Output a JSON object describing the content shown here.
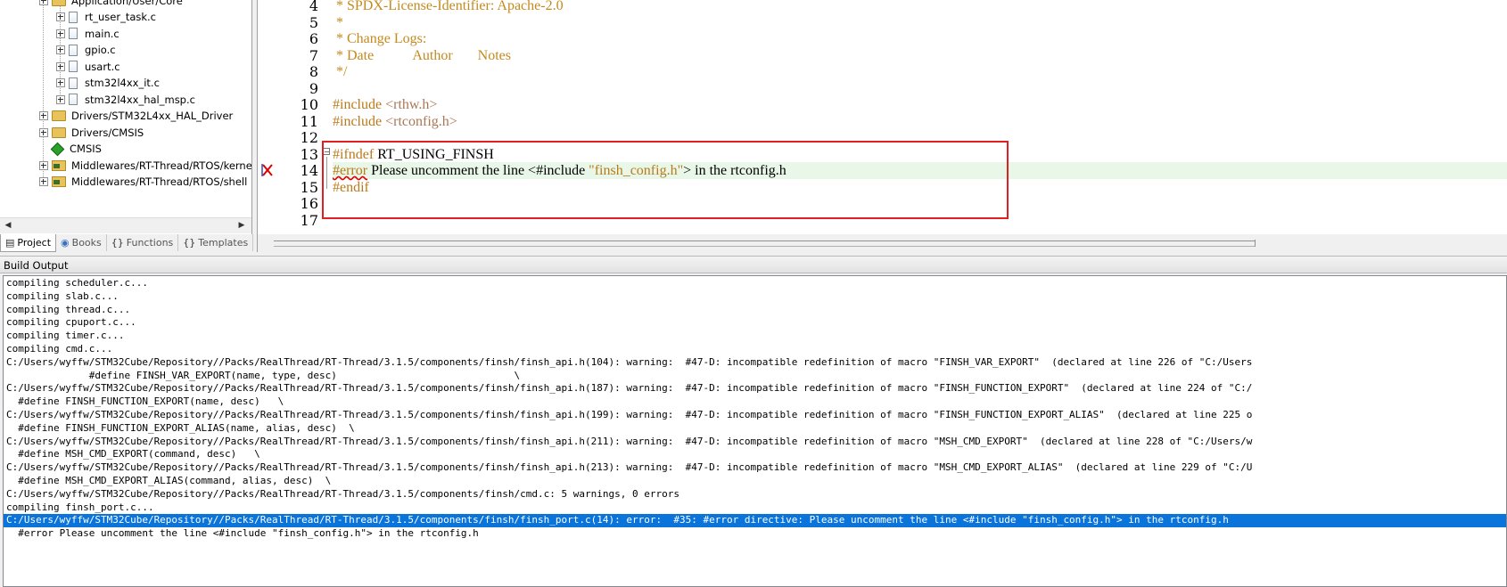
{
  "tree": {
    "top_group_label": "Application/User/Core",
    "files": [
      "rt_user_task.c",
      "main.c",
      "gpio.c",
      "usart.c",
      "stm32l4xx_it.c",
      "stm32l4xx_hal_msp.c"
    ],
    "groups": [
      {
        "label": "Drivers/STM32L4xx_HAL_Driver",
        "icon": "folder-icon"
      },
      {
        "label": "Drivers/CMSIS",
        "icon": "folder-icon"
      },
      {
        "label": "CMSIS",
        "icon": "cmsis-diamond-icon"
      },
      {
        "label": "Middlewares/RT-Thread/RTOS/kernel",
        "icon": "component-folder-icon"
      },
      {
        "label": "Middlewares/RT-Thread/RTOS/shell",
        "icon": "component-folder-icon"
      }
    ]
  },
  "tree_tabs": [
    {
      "label": "Project",
      "icon": "project-icon",
      "active": true
    },
    {
      "label": "Books",
      "icon": "books-icon",
      "active": false
    },
    {
      "label": "Functions",
      "icon": "{}",
      "active": false
    },
    {
      "label": "Templates",
      "icon": "{}",
      "active": false
    }
  ],
  "editor": {
    "line_numbers": [
      "4",
      "5",
      "6",
      "7",
      "8",
      "9",
      "10",
      "11",
      "12",
      "13",
      "14",
      "15",
      "16",
      "17"
    ],
    "lines": {
      "l4": " * SPDX-License-Identifier: Apache-2.0",
      "l5": " *",
      "l6": " * Change Logs:",
      "l7": " * Date           Author       Notes",
      "l8": " */",
      "l10_kw": "#include ",
      "l10_hdr": "<rthw.h>",
      "l11_kw": "#include ",
      "l11_hdr": "<rtconfig.h>",
      "l13_kw": "#ifndef",
      "l13_rest": " RT_USING_FINSH",
      "l14_kw": "#error",
      "l14_a": " Please uncomment the line <#include ",
      "l14_str": "\"finsh_config.h\"",
      "l14_b": "> in the rtconfig.h",
      "l15_kw": "#endif"
    },
    "highlight_color": "#e8f7e8",
    "annotation_color": "#e02020"
  },
  "build": {
    "title": "Build Output",
    "lines": [
      "compiling scheduler.c...",
      "compiling slab.c...",
      "compiling thread.c...",
      "compiling cpuport.c...",
      "compiling timer.c...",
      "compiling cmd.c...",
      "C:/Users/wyffw/STM32Cube/Repository//Packs/RealThread/RT-Thread/3.1.5/components/finsh/finsh_api.h(104): warning:  #47-D: incompatible redefinition of macro \"FINSH_VAR_EXPORT\"  (declared at line 226 of \"C:/Users",
      "              #define FINSH_VAR_EXPORT(name, type, desc)                              \\",
      "C:/Users/wyffw/STM32Cube/Repository//Packs/RealThread/RT-Thread/3.1.5/components/finsh/finsh_api.h(187): warning:  #47-D: incompatible redefinition of macro \"FINSH_FUNCTION_EXPORT\"  (declared at line 224 of \"C:/",
      "  #define FINSH_FUNCTION_EXPORT(name, desc)   \\",
      "C:/Users/wyffw/STM32Cube/Repository//Packs/RealThread/RT-Thread/3.1.5/components/finsh/finsh_api.h(199): warning:  #47-D: incompatible redefinition of macro \"FINSH_FUNCTION_EXPORT_ALIAS\"  (declared at line 225 o",
      "  #define FINSH_FUNCTION_EXPORT_ALIAS(name, alias, desc)  \\",
      "C:/Users/wyffw/STM32Cube/Repository//Packs/RealThread/RT-Thread/3.1.5/components/finsh/finsh_api.h(211): warning:  #47-D: incompatible redefinition of macro \"MSH_CMD_EXPORT\"  (declared at line 228 of \"C:/Users/w",
      "  #define MSH_CMD_EXPORT(command, desc)   \\",
      "C:/Users/wyffw/STM32Cube/Repository//Packs/RealThread/RT-Thread/3.1.5/components/finsh/finsh_api.h(213): warning:  #47-D: incompatible redefinition of macro \"MSH_CMD_EXPORT_ALIAS\"  (declared at line 229 of \"C:/U",
      "  #define MSH_CMD_EXPORT_ALIAS(command, alias, desc)  \\",
      "C:/Users/wyffw/STM32Cube/Repository//Packs/RealThread/RT-Thread/3.1.5/components/finsh/cmd.c: 5 warnings, 0 errors",
      "compiling finsh_port.c...",
      "C:/Users/wyffw/STM32Cube/Repository//Packs/RealThread/RT-Thread/3.1.5/components/finsh/finsh_port.c(14): error:  #35: #error directive: Please uncomment the line <#include \"finsh_config.h\"> in the rtconfig.h",
      "  #error Please uncomment the line <#include \"finsh_config.h\"> in the rtconfig.h"
    ],
    "selected_index": 18,
    "selection_color": "#0a74da"
  }
}
